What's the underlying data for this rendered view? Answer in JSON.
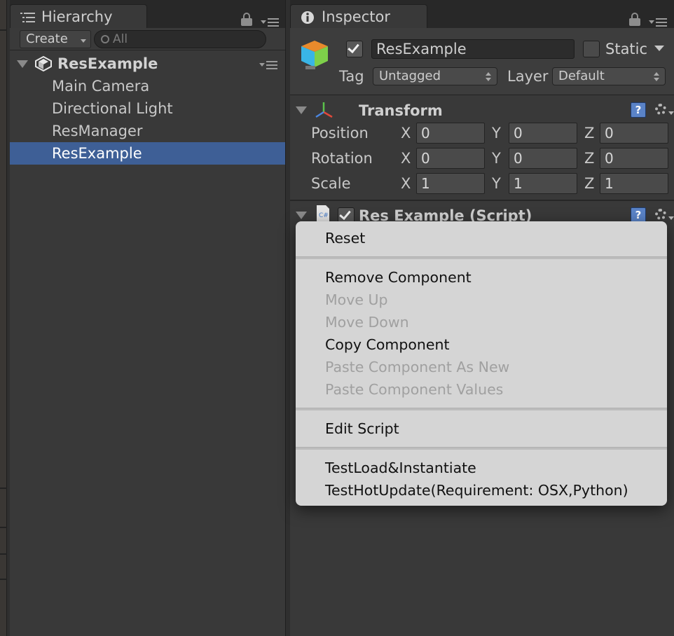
{
  "hierarchy": {
    "tab_label": "Hierarchy",
    "create_label": "Create",
    "search_placeholder": "All",
    "root": "ResExample",
    "items": [
      "Main Camera",
      "Directional Light",
      "ResManager",
      "ResExample"
    ]
  },
  "inspector": {
    "tab_label": "Inspector",
    "object_name": "ResExample",
    "static_label": "Static",
    "tag_label": "Tag",
    "tag_value": "Untagged",
    "layer_label": "Layer",
    "layer_value": "Default",
    "transform": {
      "title": "Transform",
      "rows": [
        {
          "label": "Position",
          "x": "0",
          "y": "0",
          "z": "0"
        },
        {
          "label": "Rotation",
          "x": "0",
          "y": "0",
          "z": "0"
        },
        {
          "label": "Scale",
          "x": "1",
          "y": "1",
          "z": "1"
        }
      ],
      "axis": {
        "x": "X",
        "y": "Y",
        "z": "Z"
      }
    },
    "script_component": {
      "title": "Res Example (Script)"
    }
  },
  "context_menu": {
    "items": [
      {
        "label": "Reset",
        "enabled": true
      },
      {
        "label": "Remove Component",
        "enabled": true
      },
      {
        "label": "Move Up",
        "enabled": false
      },
      {
        "label": "Move Down",
        "enabled": false
      },
      {
        "label": "Copy Component",
        "enabled": true
      },
      {
        "label": "Paste Component As New",
        "enabled": false
      },
      {
        "label": "Paste Component Values",
        "enabled": false
      },
      {
        "label": "Edit Script",
        "enabled": true
      },
      {
        "label": "TestLoad&Instantiate",
        "enabled": true
      },
      {
        "label": "TestHotUpdate(Requirement: OSX,Python)",
        "enabled": true
      }
    ]
  },
  "colors": {
    "selection": "#3e5f96",
    "panel": "#393939",
    "menu": "#d5d5d5"
  }
}
